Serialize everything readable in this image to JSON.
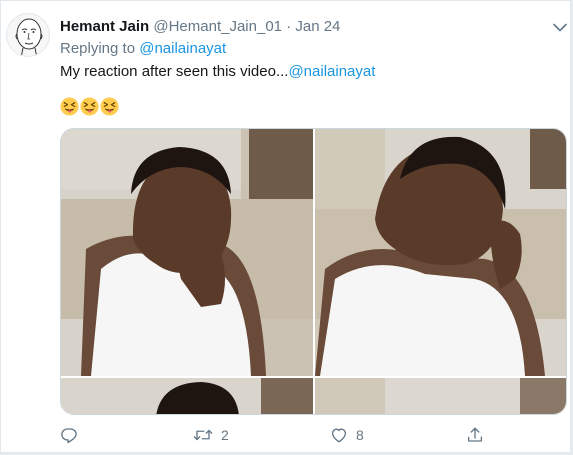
{
  "tweet": {
    "author_name": "Hemant Jain",
    "author_handle": "@Hemant_Jain_01",
    "separator": "·",
    "date": "Jan 24",
    "replying_prefix": "Replying to ",
    "replying_to": "@nailainayat",
    "text": "My reaction after seen this video...",
    "mention": "@nailainayat",
    "emojis": [
      "squinting-face-with-tongue",
      "squinting-face-with-tongue",
      "squinting-face-with-tongue"
    ],
    "media": {
      "type": "photo-grid",
      "photo_count": 4
    },
    "actions": {
      "reply_count": "",
      "retweet_count": "2",
      "like_count": "8"
    }
  },
  "colors": {
    "link": "#1b95e0",
    "text_primary": "#14171a",
    "text_secondary": "#657786",
    "background": "#e6ecf0"
  },
  "icons": {
    "caret": "chevron-down-icon",
    "reply": "reply-icon",
    "retweet": "retweet-icon",
    "like": "heart-icon",
    "share": "share-icon"
  }
}
